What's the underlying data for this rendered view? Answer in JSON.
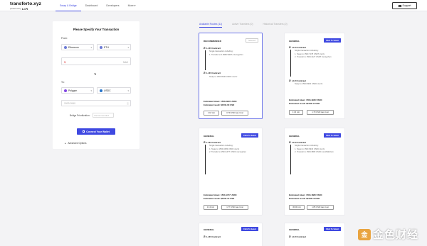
{
  "header": {
    "brand": "transferto.xyz",
    "powered_by": "powered by",
    "powered_brand": "LI.FI",
    "nav": [
      "Swap & Bridge",
      "Dashboard",
      "Developers",
      "More ▾"
    ],
    "support": "Support"
  },
  "form": {
    "title": "Please Specify Your Transaction",
    "from_label": "From:",
    "from_chain": "Ethereum",
    "from_token": "ETH",
    "max": "MAX",
    "to_label": "To:",
    "to_chain": "Polygon",
    "to_token": "USDC",
    "to_amount_placeholder": "1503.0940",
    "bridge_label": "Bridge Prioritization:",
    "bridge_value": "Recommended",
    "connect_button": "Connect Your Wallet",
    "advanced": "Advanced Options"
  },
  "tabs": [
    "Available Routes (11)",
    "Active Transfers (0)",
    "Historical Transfers (0)"
  ],
  "cards": [
    {
      "tag": "RECOMMENDED",
      "badge": "Selected",
      "step1": "LI.FI Contract",
      "sub1": [
        "Single transaction including:",
        "1. Transfer to 0.9999 WETH via Hyphen"
      ],
      "step2": "LI.FI Contract",
      "sub2": [
        "Swap to 1503.0940 USDC via 0x"
      ],
      "est_token": "Estimated token: 1503.0940 USDC",
      "est_result": "Estimated result: $1503.00 USD",
      "time": "1:18 min",
      "gas": "0.79 USD Gas Cost"
    },
    {
      "tag": "GENERAL",
      "button": "Click To Select",
      "step1": "LI.FI Contract",
      "sub1": [
        "Single transaction including:",
        "1. Swap to 1503.7178 USDT via 0x",
        "2. Transfer to 1503.4127 USDT via Hyphen"
      ],
      "step2": "LI.FI Contract",
      "sub2": [
        "Swap to 1503.4930 USDC via 0x"
      ],
      "est_token": "Estimated token: 1503.4930 USDC",
      "est_result": "Estimated result: $1503.41 USD",
      "time": "1:40 min",
      "gas": "1.79 USD Gas Cost"
    },
    {
      "tag": "GENERAL",
      "button": "Click To Select",
      "step1": "LI.FI Contract",
      "sub1": [
        "Single transaction including:",
        "1. Swap to 1504.0483 USDC via 0x",
        "2. Transfer to 1503.1477 USDC via Hyphen"
      ],
      "est_token": "Estimated token: 1503.1477 USDC",
      "est_result": "Estimated result: $1503.15 USD",
      "time": "1:13 min",
      "gas": "1.77 USD Gas Cost"
    },
    {
      "tag": "GENERAL",
      "button": "Click To Select",
      "step1": "LI.FI Contract",
      "sub1": [
        "Single transaction including:",
        "1. Swap to 1503.0940 USDC via 0x",
        "2. Transfer to 1503.1880 USDC via Multichain"
      ],
      "est_token": "Estimated token: 1503.1880 USDC",
      "est_result": "Estimated result: $1503.19 USD",
      "time": "30:00 min",
      "gas": "1.85 USD Gas Cost"
    },
    {
      "tag": "GENERAL",
      "button": "Click To Select",
      "step1": "LI.FI Contract"
    },
    {
      "tag": "GENERAL",
      "button": "Click To Select",
      "step1": "LI.FI Contract"
    }
  ],
  "watermark": {
    "logo": "金",
    "text": "金色财经"
  },
  "colors": {
    "accent": "#3f49e1",
    "eth": "#6c7bd6",
    "polygon": "#8247e5",
    "usdc": "#2775ca"
  }
}
